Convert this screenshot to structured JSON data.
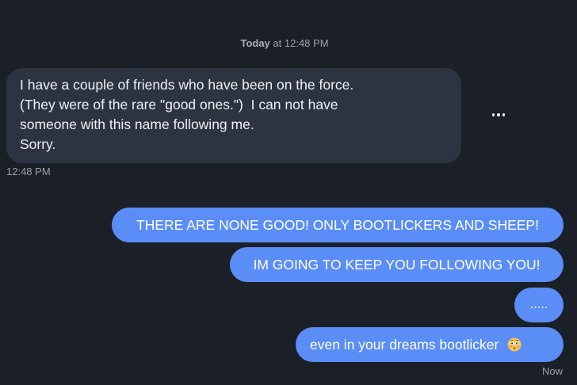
{
  "header": {
    "day_label": "Today",
    "time_label": "at 12:48 PM"
  },
  "incoming": {
    "lines": [
      "I have a couple of friends who have been on the force.",
      "(They were of the rare \"good ones.\")  I can not have",
      "someone with this name following me.",
      "Sorry."
    ],
    "time": "12:48 PM"
  },
  "outgoing": {
    "messages": [
      "THERE ARE NONE GOOD! ONLY BOOTLICKERS AND SHEEP!",
      "IM GOING TO KEEP YOU FOLLOWING YOU!",
      ".....",
      "even in your dreams bootlicker"
    ],
    "last_emoji": "flushed-face-emoji",
    "time": "Now"
  },
  "actions": {
    "more_icon": "more-horizontal-icon"
  },
  "colors": {
    "background": "#1b1f27",
    "incoming_bubble": "#2d3340",
    "outgoing_bubble": "#5b8df6",
    "meta_text": "#9aa1ac"
  }
}
